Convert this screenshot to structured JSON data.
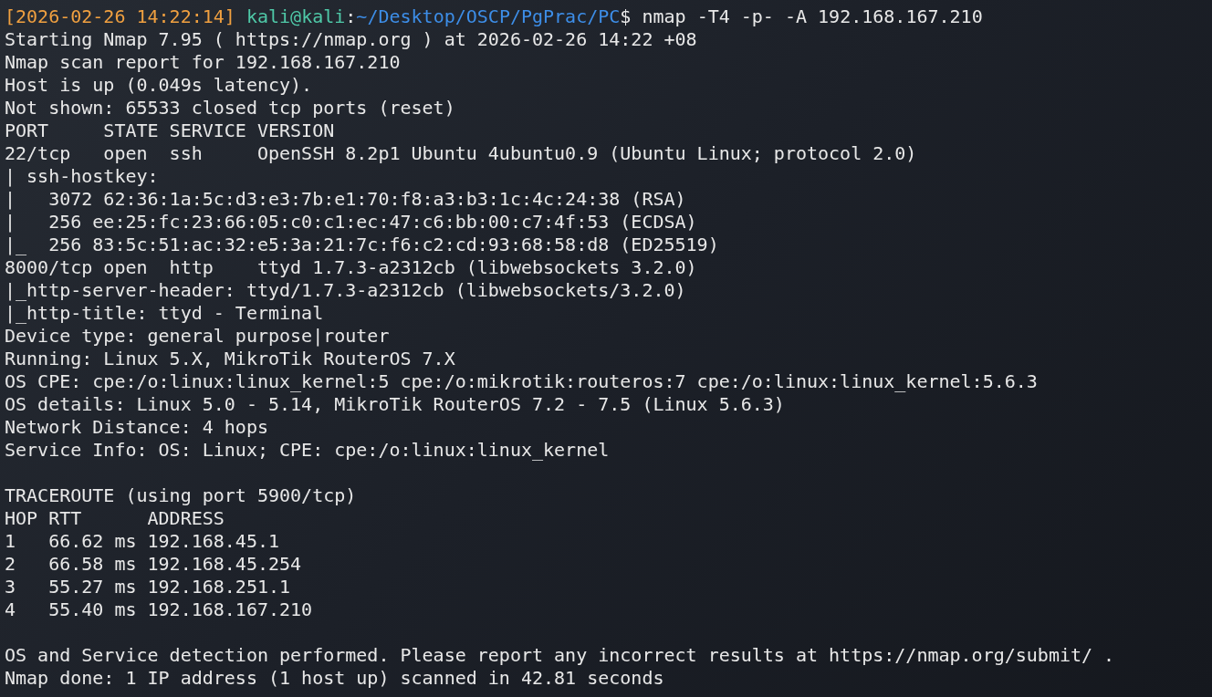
{
  "prompt": {
    "timestamp": "[2026-02-26 14:22:14]",
    "user_host": "kali@kali",
    "separator": ":",
    "path": "~/Desktop/OSCP/PgPrac/PC",
    "symbol": "$",
    "command": "nmap -T4 -p- -A 192.168.167.210"
  },
  "output_blocks": [
    {
      "lines": [
        "Starting Nmap 7.95 ( https://nmap.org ) at 2026-02-26 14:22 +08",
        "Nmap scan report for 192.168.167.210",
        "Host is up (0.049s latency).",
        "Not shown: 65533 closed tcp ports (reset)",
        "PORT     STATE SERVICE VERSION",
        "22/tcp   open  ssh     OpenSSH 8.2p1 Ubuntu 4ubuntu0.9 (Ubuntu Linux; protocol 2.0)",
        "| ssh-hostkey: ",
        "|   3072 62:36:1a:5c:d3:e3:7b:e1:70:f8:a3:b3:1c:4c:24:38 (RSA)",
        "|   256 ee:25:fc:23:66:05:c0:c1:ec:47:c6:bb:00:c7:4f:53 (ECDSA)",
        "|_  256 83:5c:51:ac:32:e5:3a:21:7c:f6:c2:cd:93:68:58:d8 (ED25519)",
        "8000/tcp open  http    ttyd 1.7.3-a2312cb (libwebsockets 3.2.0)",
        "|_http-server-header: ttyd/1.7.3-a2312cb (libwebsockets/3.2.0)",
        "|_http-title: ttyd - Terminal",
        "Device type: general purpose|router",
        "Running: Linux 5.X, MikroTik RouterOS 7.X",
        "OS CPE: cpe:/o:linux:linux_kernel:5 cpe:/o:mikrotik:routeros:7 cpe:/o:linux:linux_kernel:5.6.3",
        "OS details: Linux 5.0 - 5.14, MikroTik RouterOS 7.2 - 7.5 (Linux 5.6.3)",
        "Network Distance: 4 hops",
        "Service Info: OS: Linux; CPE: cpe:/o:linux:linux_kernel"
      ]
    },
    {
      "lines": [
        "TRACEROUTE (using port 5900/tcp)",
        "HOP RTT      ADDRESS",
        "1   66.62 ms 192.168.45.1",
        "2   66.58 ms 192.168.45.254",
        "3   55.27 ms 192.168.251.1",
        "4   55.40 ms 192.168.167.210"
      ]
    },
    {
      "lines": [
        "OS and Service detection performed. Please report any incorrect results at https://nmap.org/submit/ .",
        "Nmap done: 1 IP address (1 host up) scanned in 42.81 seconds"
      ]
    }
  ]
}
